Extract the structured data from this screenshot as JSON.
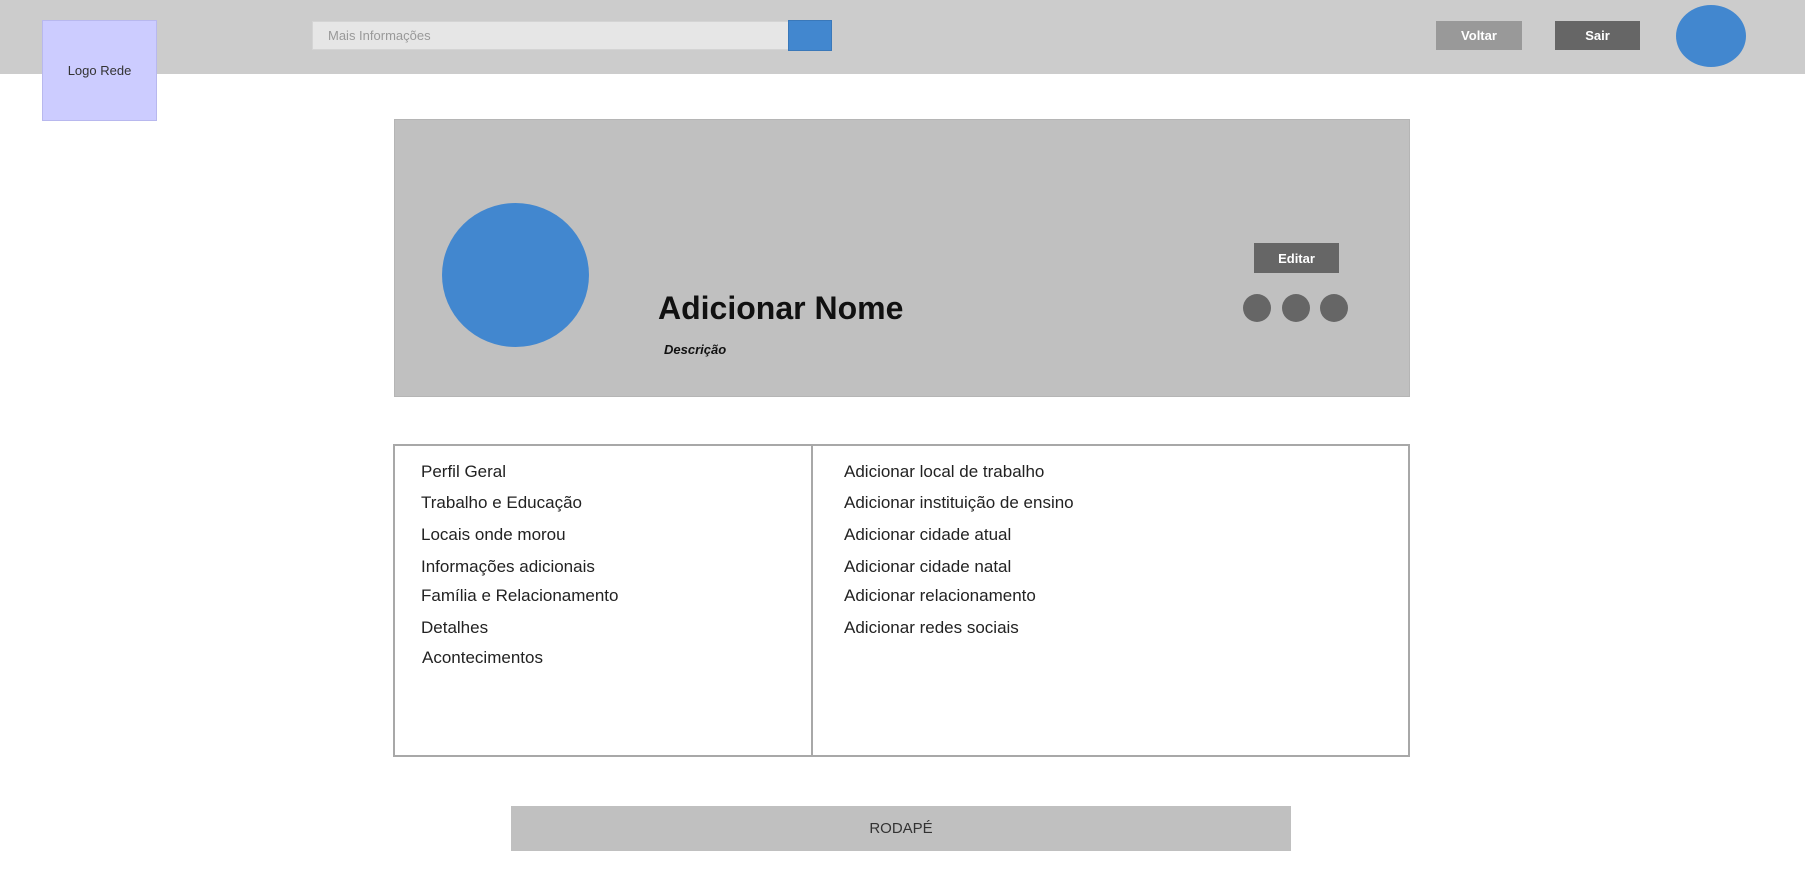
{
  "header": {
    "logo_text": "Logo Rede",
    "search_placeholder": "Mais Informações",
    "search_button_icon": "search-icon",
    "back_label": "Voltar",
    "logout_label": "Sair",
    "avatar_color": "#4287cf"
  },
  "profile": {
    "name": "Adicionar Nome",
    "description": "Descrição",
    "edit_label": "Editar",
    "avatar_color": "#4287cf",
    "social_icon_count": 3
  },
  "about_menu": {
    "items": [
      "Perfil Geral",
      "Trabalho e Educação",
      "Locais onde morou",
      "Informações adicionais",
      "Família e Relacionamento",
      "Detalhes",
      "Acontecimentos"
    ]
  },
  "about_content": {
    "items": [
      "Adicionar local de trabalho",
      "Adicionar instituição de ensino",
      "Adicionar cidade atual",
      "Adicionar cidade natal",
      "Adicionar relacionamento",
      "Adicionar redes sociais"
    ]
  },
  "footer": {
    "text": "RODAPÉ"
  },
  "colors": {
    "topbar": "#cccccc",
    "logo_bg": "#ccccff",
    "accent_blue": "#4287cf",
    "cover_bg": "#c0c0c0",
    "dark_button": "#666666",
    "light_button": "#999999"
  }
}
